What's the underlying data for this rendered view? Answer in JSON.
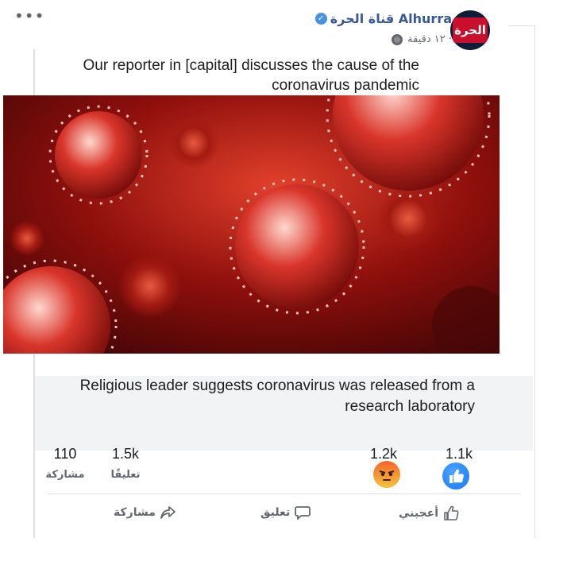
{
  "header": {
    "page_name": "قناة الحرة Alhurra",
    "time_ago": "١٢ دقيقة ·",
    "avatar_text": "الحرة",
    "more_icon": "more-dots-icon"
  },
  "post": {
    "text": "Our reporter in [capital] discusses the cause of the coronavirus pandemic"
  },
  "link": {
    "title": "Religious leader suggests coronavirus was released from a research laboratory"
  },
  "stats": {
    "shares_count": "110",
    "shares_label": "مشاركة",
    "comments_count": "1.5k",
    "comments_label": "تعليقًا",
    "angry_count": "1.2k",
    "like_count": "1.1k"
  },
  "actions": {
    "like_label": "أعجبني",
    "comment_label": "تعليق",
    "share_label": "مشاركة"
  },
  "colors": {
    "link_blue": "#385898",
    "like_blue": "#1677f2",
    "muted": "#606770"
  }
}
